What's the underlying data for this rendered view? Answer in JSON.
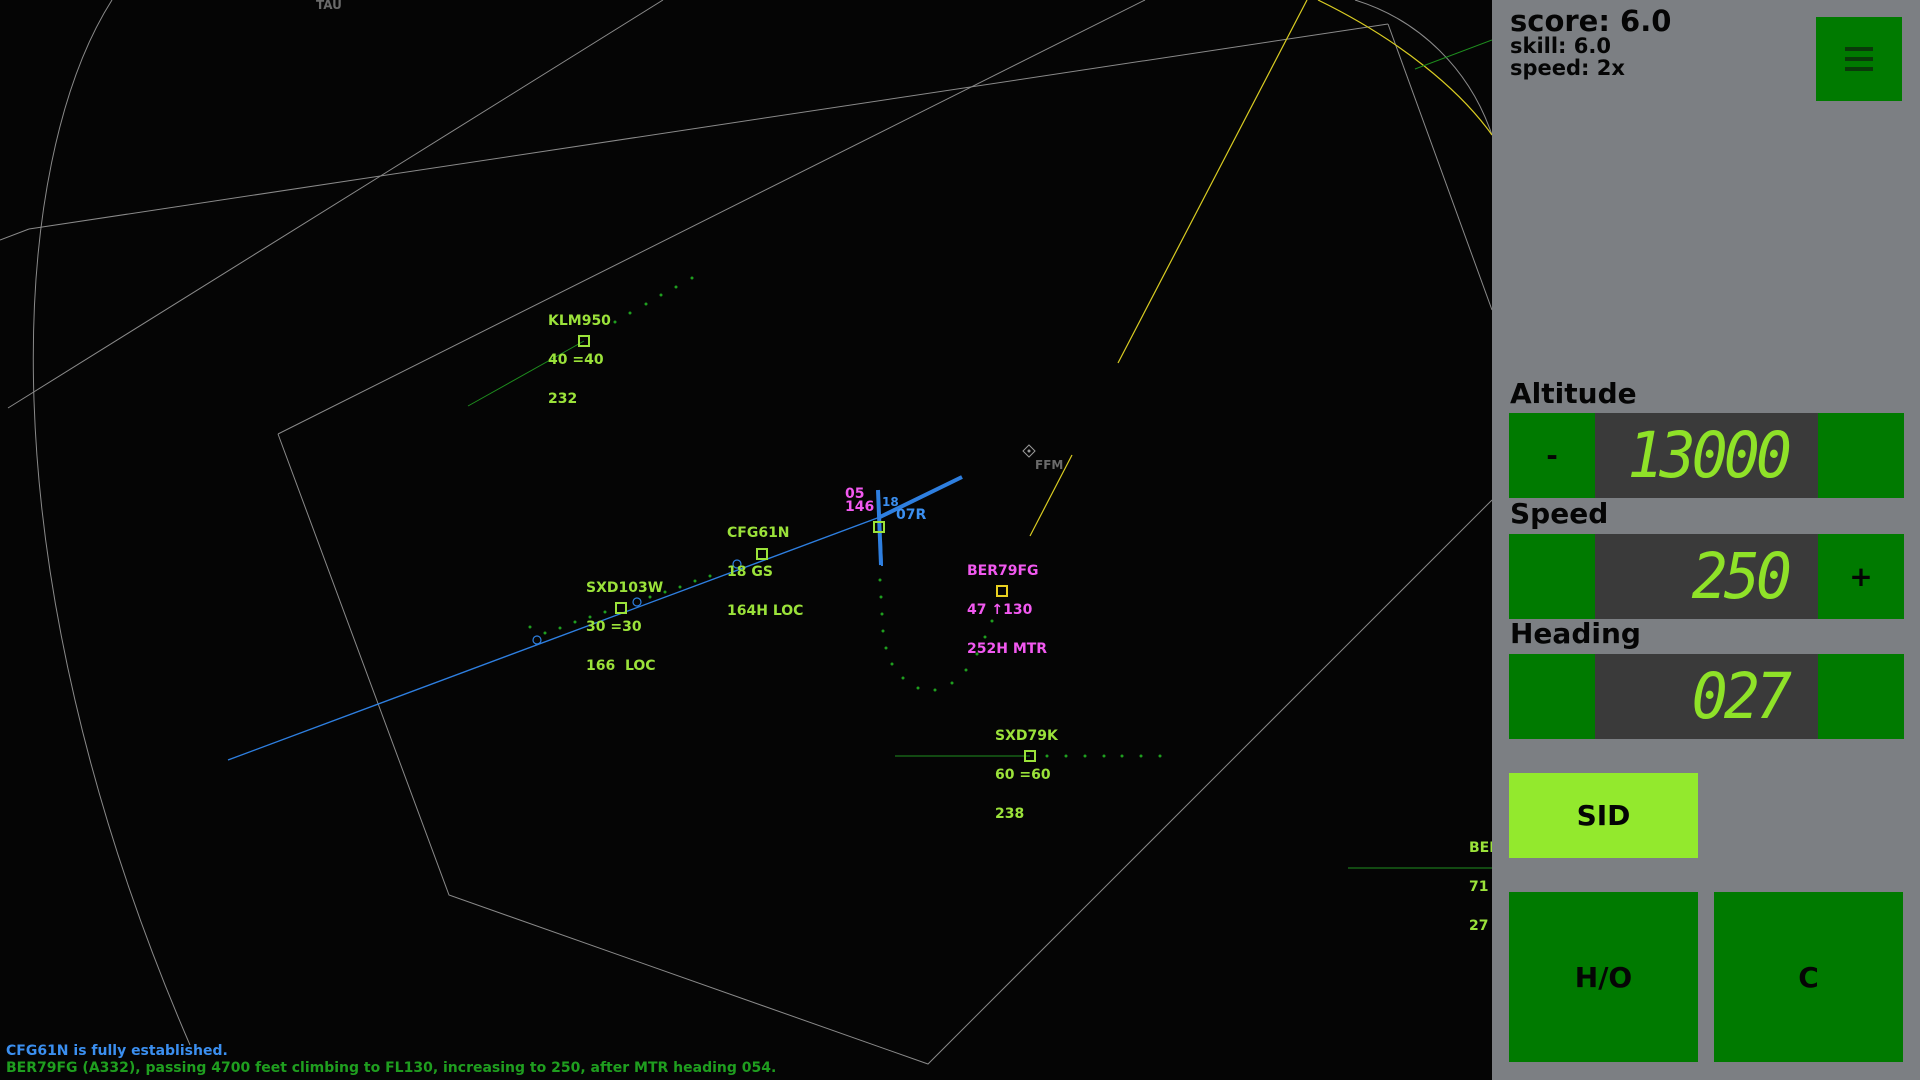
{
  "radar": {
    "fix_tau": "TAU",
    "fix_ffm": "FFM",
    "runway_07r": "07R",
    "runway_18": "18",
    "runway_05_label": "05",
    "runway_05_sub": "146",
    "aircraft": [
      {
        "callsign": "KLM950",
        "line2": "40 =40",
        "line3": "232",
        "color": "#9be23a"
      },
      {
        "callsign": "CFG61N",
        "line2": "18 GS",
        "line3": "164H LOC",
        "color": "#9be23a"
      },
      {
        "callsign": "SXD103W",
        "line2": "30 =30",
        "line3": "166  LOC",
        "color": "#9be23a"
      },
      {
        "callsign": "BER79FG",
        "line2": "47 ↑130",
        "line3": "252H MTR",
        "color": "#f259f0"
      },
      {
        "callsign": "SXD79K",
        "line2": "60 =60",
        "line3": "238",
        "color": "#9be23a"
      },
      {
        "callsign": "BER",
        "line2": "71",
        "line3": "27",
        "color": "#9be23a"
      }
    ],
    "messages": [
      {
        "text": "CFG61N is fully established.",
        "color": "#3b8ff0"
      },
      {
        "text": "BER79FG (A332), passing 4700 feet climbing to FL130, increasing to 250, after MTR heading 054.",
        "color": "#1f9e1f"
      }
    ]
  },
  "panel": {
    "score": "score: 6.0",
    "skill": "skill: 6.0",
    "speed": "speed: 2x",
    "menu_icon": "hamburger-menu-icon",
    "altitude": {
      "title": "Altitude",
      "minus": "-",
      "value": "13000",
      "plus": ""
    },
    "speed_ctrl": {
      "title": "Speed",
      "minus": "",
      "value": "250",
      "plus": "+"
    },
    "heading": {
      "title": "Heading",
      "minus": "",
      "value": "027",
      "plus": ""
    },
    "sid_label": "SID",
    "handoff_label": "H/O",
    "clear_label": "C",
    "accent": "#007a00",
    "highlight": "#93e92d"
  }
}
